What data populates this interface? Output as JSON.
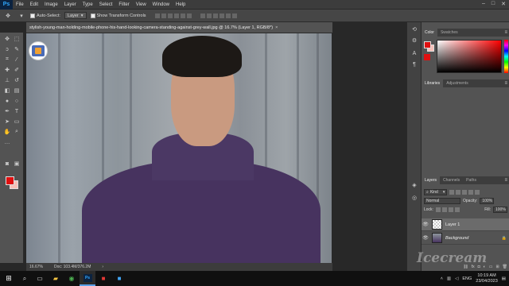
{
  "app": {
    "logo": "Ps",
    "menu": [
      "File",
      "Edit",
      "Image",
      "Layer",
      "Type",
      "Select",
      "Filter",
      "View",
      "Window",
      "Help"
    ],
    "window_controls": [
      "–",
      "□",
      "✕"
    ]
  },
  "options_bar": {
    "tool_icon": "move-icon",
    "auto_select_label": "Auto-Select:",
    "auto_select_value": "Layer",
    "show_transform_label": "Show Transform Controls"
  },
  "document": {
    "tab_title": "stylish-young-man-holding-mobile-phone-his-hand-looking-camera-standing-against-grey-wall.jpg @ 16.7% (Layer 1, RGB/8*)",
    "close": "×",
    "status_zoom": "16.67%",
    "status_doc": "Doc: 103.4M/376.2M",
    "status_arrow": "›"
  },
  "colors": {
    "foreground": "#e01010",
    "background": "#f7c0b8"
  },
  "panels": {
    "color_tabs": [
      "Color",
      "Swatches"
    ],
    "library_tabs": [
      "Libraries",
      "Adjustments"
    ],
    "layers_tabs": [
      "Layers",
      "Channels",
      "Paths"
    ],
    "kind_label": "Kind",
    "blend_mode": "Normal",
    "opacity_label": "Opacity:",
    "opacity_value": "100%",
    "lock_label": "Lock:",
    "fill_label": "Fill:",
    "fill_value": "100%",
    "layers": [
      {
        "name": "Layer 1",
        "selected": true
      },
      {
        "name": "Background",
        "selected": false
      }
    ],
    "footer_icons": [
      "link-icon",
      "fx-icon",
      "mask-icon",
      "adjustment-icon",
      "folder-icon",
      "new-layer-icon",
      "trash-icon"
    ]
  },
  "watermark": "Icecream",
  "taskbar": {
    "lang": "ENG",
    "time": "10:19 AM",
    "date": "23/04/2023"
  }
}
